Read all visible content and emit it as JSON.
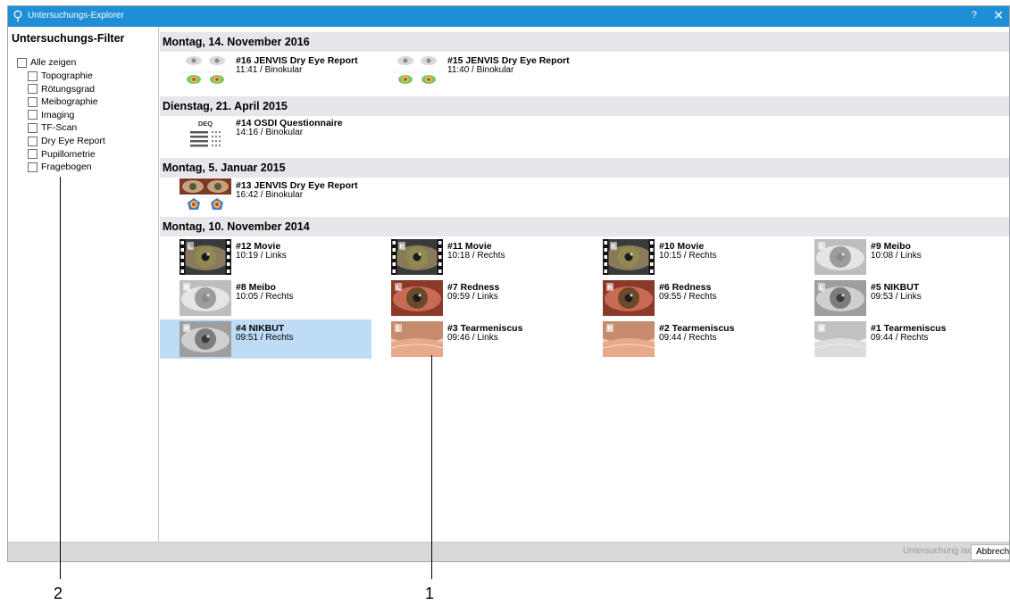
{
  "window": {
    "title": "Untersuchungs-Explorer",
    "help": "?",
    "close": "✕"
  },
  "sidebar": {
    "title": "Untersuchungs-Filter",
    "all_label": "Alle zeigen",
    "filters": [
      "Topographie",
      "Rötungsgrad",
      "Meibographie",
      "Imaging",
      "TF-Scan",
      "Dry Eye Report",
      "Pupillometrie",
      "Fragebogen"
    ]
  },
  "groups": [
    {
      "date": "Montag, 14. November 2016",
      "items": [
        {
          "title": "#16 JENVIS Dry Eye Report",
          "sub": "11:41 / Binokular",
          "thumb": "report-light",
          "selected": false
        },
        {
          "title": "#15 JENVIS Dry Eye Report",
          "sub": "11:40 / Binokular",
          "thumb": "report-light",
          "selected": false
        }
      ]
    },
    {
      "date": "Dienstag, 21. April 2015",
      "items": [
        {
          "title": "#14 OSDI Questionnaire",
          "sub": "14:16 / Binokular",
          "thumb": "deq",
          "label": "DEQ",
          "selected": false
        }
      ]
    },
    {
      "date": "Montag, 5. Januar 2015",
      "items": [
        {
          "title": "#13 JENVIS Dry Eye Report",
          "sub": "16:42 / Binokular",
          "thumb": "report-red",
          "selected": false
        }
      ]
    },
    {
      "date": "Montag, 10. November 2014",
      "items": [
        {
          "title": "#12 Movie",
          "sub": "10:19 / Links",
          "thumb": "movie",
          "eye": "L",
          "selected": false
        },
        {
          "title": "#11 Movie",
          "sub": "10:18 / Rechts",
          "thumb": "movie",
          "eye": "R",
          "selected": false
        },
        {
          "title": "#10 Movie",
          "sub": "10:15 / Rechts",
          "thumb": "movie",
          "eye": "R",
          "selected": false
        },
        {
          "title": "#9 Meibo",
          "sub": "10:08 / Links",
          "thumb": "meibo",
          "eye": "L",
          "selected": false
        },
        {
          "title": "#8 Meibo",
          "sub": "10:05 / Rechts",
          "thumb": "meibo",
          "eye": "R",
          "selected": false
        },
        {
          "title": "#7 Redness",
          "sub": "09:59 / Links",
          "thumb": "redness",
          "eye": "L",
          "selected": false
        },
        {
          "title": "#6 Redness",
          "sub": "09:55 / Rechts",
          "thumb": "redness",
          "eye": "R",
          "selected": false
        },
        {
          "title": "#5 NIKBUT",
          "sub": "09:53 / Links",
          "thumb": "nikbut",
          "eye": "L",
          "selected": false
        },
        {
          "title": "#4 NIKBUT",
          "sub": "09:51 / Rechts",
          "thumb": "nikbut",
          "eye": "R",
          "selected": true
        },
        {
          "title": "#3 Tearmeniscus",
          "sub": "09:46 / Links",
          "thumb": "tear",
          "eye": "L",
          "selected": false
        },
        {
          "title": "#2 Tearmeniscus",
          "sub": "09:44 / Rechts",
          "thumb": "tear",
          "eye": "R",
          "selected": false
        },
        {
          "title": "#1 Tearmeniscus",
          "sub": "09:44 / Rechts",
          "thumb": "tear-gray",
          "eye": "R",
          "selected": false
        }
      ]
    }
  ],
  "footer": {
    "load_label": "Untersuchung laden",
    "cancel_label": "Abbrechen"
  },
  "callouts": {
    "left": "2",
    "right": "1"
  },
  "colors": {
    "titlebar": "#1e8fd6",
    "date_header": "#e6e6ec",
    "selected": "#bfdcf7",
    "statusbar": "#d9d9d9"
  }
}
